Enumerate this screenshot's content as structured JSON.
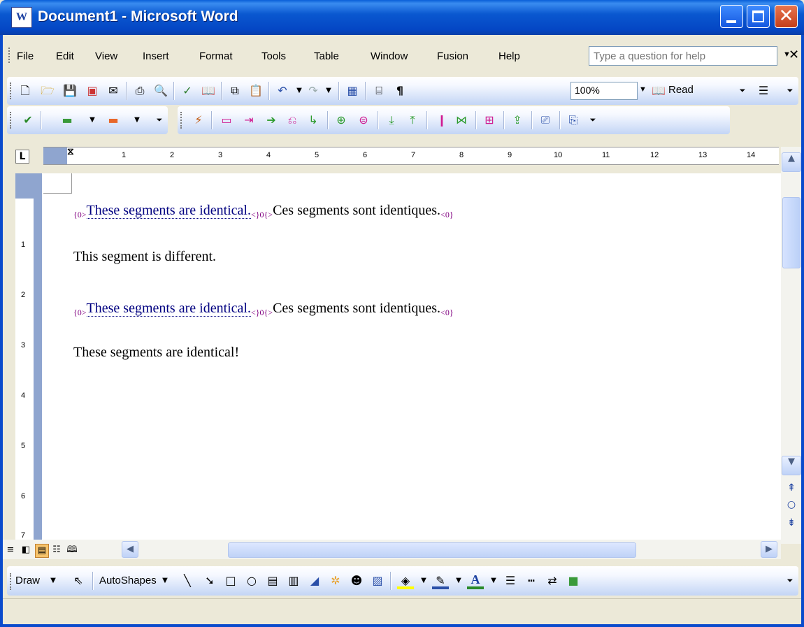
{
  "window": {
    "title": "Document1 - Microsoft Word"
  },
  "menu": {
    "items": [
      {
        "label": "File"
      },
      {
        "label": "Edit"
      },
      {
        "label": "View"
      },
      {
        "label": "Insert"
      },
      {
        "label": "Format"
      },
      {
        "label": "Tools"
      },
      {
        "label": "Table"
      },
      {
        "label": "Window"
      },
      {
        "label": "Fusion"
      },
      {
        "label": "Help"
      }
    ],
    "help_placeholder": "Type a question for help"
  },
  "toolbar": {
    "zoom": "100%",
    "read_label": "Read"
  },
  "ruler": {
    "ticks": [
      "1",
      "2",
      "3",
      "4",
      "5",
      "6",
      "7",
      "8",
      "9",
      "10",
      "11",
      "12",
      "13",
      "14"
    ]
  },
  "document": {
    "lines": [
      {
        "tag_open": "{0>",
        "source": "These segments are identical.",
        "tag_mid": "<}0{>",
        "target": "Ces segments sont identiques.",
        "tag_close": "<0}"
      },
      {
        "text": "This segment is different."
      },
      {
        "tag_open": "{0>",
        "source": "These segments are identical.",
        "tag_mid": "<}0{>",
        "target": "Ces segments sont identiques.",
        "tag_close": "<0}"
      },
      {
        "text": "These segments are identical!"
      }
    ]
  },
  "drawing": {
    "draw_label": "Draw",
    "autoshapes_label": "AutoShapes"
  },
  "vruler": {
    "ticks": [
      "1",
      "2",
      "3",
      "4",
      "5",
      "6",
      "7"
    ]
  }
}
